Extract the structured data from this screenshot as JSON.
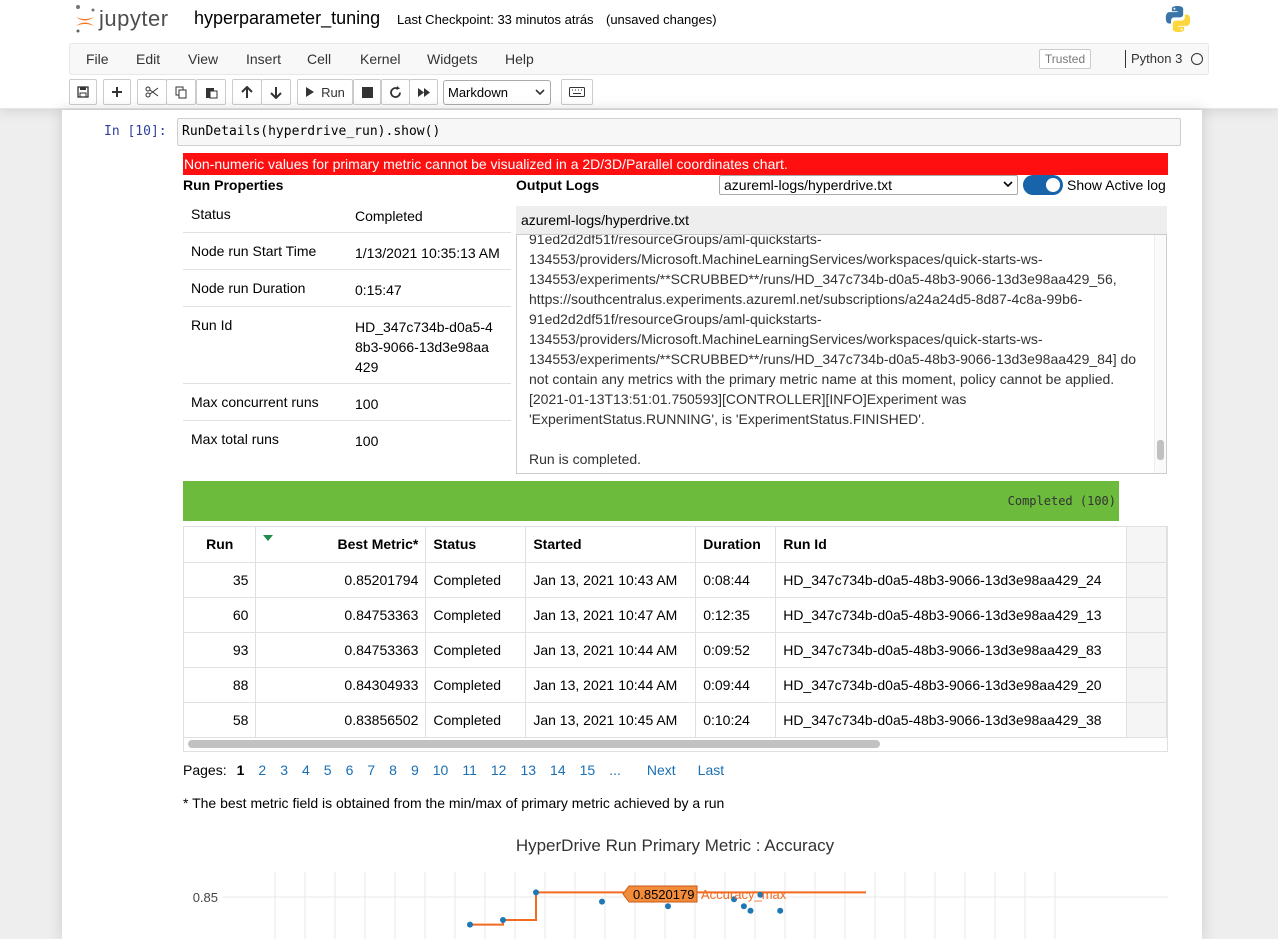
{
  "app": {
    "logo_text": "jupyter",
    "notebook_title": "hyperparameter_tuning",
    "checkpoint": "Last Checkpoint: 33 minutos atrás",
    "unsaved": "(unsaved changes)"
  },
  "menu": {
    "items": [
      "File",
      "Edit",
      "View",
      "Insert",
      "Cell",
      "Kernel",
      "Widgets",
      "Help"
    ],
    "trusted": "Trusted",
    "kernel": "Python 3"
  },
  "toolbar": {
    "run_label": "Run",
    "cell_type": "Markdown"
  },
  "cell": {
    "prompt": "In [10]:",
    "code": "RunDetails(hyperdrive_run).show()"
  },
  "widget": {
    "error": "Non-numeric values for primary metric cannot be visualized in a 2D/3D/Parallel coordinates chart.",
    "run_properties_title": "Run Properties",
    "output_logs_title": "Output Logs",
    "log_file_selected": "azureml-logs/hyperdrive.txt",
    "show_active_log": "Show Active log",
    "log_header": "azureml-logs/hyperdrive.txt",
    "properties": [
      {
        "key": "Status",
        "value": "Completed"
      },
      {
        "key": "Node run Start Time",
        "value": "1/13/2021 10:35:13 AM"
      },
      {
        "key": "Node run Duration",
        "value": "0:15:47"
      },
      {
        "key": "Run Id",
        "value": "HD_347c734b-d0a5-48b3-9066-13d3e98aa429"
      },
      {
        "key": "Max concurrent runs",
        "value": "100"
      },
      {
        "key": "Max total runs",
        "value": "100"
      }
    ],
    "log_lines": [
      "91ed2d2df51f/resourceGroups/aml-quickstarts-",
      "134553/providers/Microsoft.MachineLearningServices/workspaces/quick-starts-ws-",
      "134553/experiments/**SCRUBBED**/runs/HD_347c734b-d0a5-48b3-9066-13d3e98aa429_56,",
      "https://southcentralus.experiments.azureml.net/subscriptions/a24a24d5-8d87-4c8a-99b6-",
      "91ed2d2df51f/resourceGroups/aml-quickstarts-",
      "134553/providers/Microsoft.MachineLearningServices/workspaces/quick-starts-ws-",
      "134553/experiments/**SCRUBBED**/runs/HD_347c734b-d0a5-48b3-9066-13d3e98aa429_84] do",
      "not contain any metrics with the primary metric name at this moment, policy cannot be applied.",
      "[2021-01-13T13:51:01.750593][CONTROLLER][INFO]Experiment was",
      "'ExperimentStatus.RUNNING', is 'ExperimentStatus.FINISHED'.",
      "",
      "Run is completed."
    ],
    "progress_label": "Completed (100)",
    "progress_fraction": 0.95,
    "table": {
      "headers": [
        "Run",
        "Best Metric*",
        "Status",
        "Started",
        "Duration",
        "Run Id"
      ],
      "rows": [
        [
          "35",
          "0.85201794",
          "Completed",
          "Jan 13, 2021 10:43 AM",
          "0:08:44",
          "HD_347c734b-d0a5-48b3-9066-13d3e98aa429_24"
        ],
        [
          "60",
          "0.84753363",
          "Completed",
          "Jan 13, 2021 10:47 AM",
          "0:12:35",
          "HD_347c734b-d0a5-48b3-9066-13d3e98aa429_13"
        ],
        [
          "93",
          "0.84753363",
          "Completed",
          "Jan 13, 2021 10:44 AM",
          "0:09:52",
          "HD_347c734b-d0a5-48b3-9066-13d3e98aa429_83"
        ],
        [
          "88",
          "0.84304933",
          "Completed",
          "Jan 13, 2021 10:44 AM",
          "0:09:44",
          "HD_347c734b-d0a5-48b3-9066-13d3e98aa429_20"
        ],
        [
          "58",
          "0.83856502",
          "Completed",
          "Jan 13, 2021 10:45 AM",
          "0:10:24",
          "HD_347c734b-d0a5-48b3-9066-13d3e98aa429_38"
        ]
      ]
    },
    "pager": {
      "label": "Pages:",
      "pages": [
        "1",
        "2",
        "3",
        "4",
        "5",
        "6",
        "7",
        "8",
        "9",
        "10",
        "11",
        "12",
        "13",
        "14",
        "15",
        "..."
      ],
      "next": "Next",
      "last": "Last"
    },
    "footnote": "* The best metric field is obtained from the min/max of primary metric achieved by a run"
  },
  "chart_data": {
    "type": "scatter",
    "title": "HyperDrive Run Primary Metric : Accuracy",
    "ytick": "0.85",
    "max_label_value": "0.8520179",
    "max_series_name": "Accuracy_max",
    "step_line": [
      [
        0,
        0.838
      ],
      [
        1,
        0.838
      ],
      [
        1,
        0.84
      ],
      [
        2,
        0.84
      ],
      [
        2,
        0.852
      ],
      [
        12,
        0.852
      ]
    ],
    "points": [
      [
        0,
        0.838
      ],
      [
        1,
        0.84
      ],
      [
        2,
        0.852
      ],
      [
        4,
        0.848
      ],
      [
        6,
        0.846
      ],
      [
        8,
        0.849
      ],
      [
        8.3,
        0.846
      ],
      [
        8.5,
        0.844
      ],
      [
        8.8,
        0.851
      ],
      [
        9.4,
        0.844
      ]
    ]
  }
}
